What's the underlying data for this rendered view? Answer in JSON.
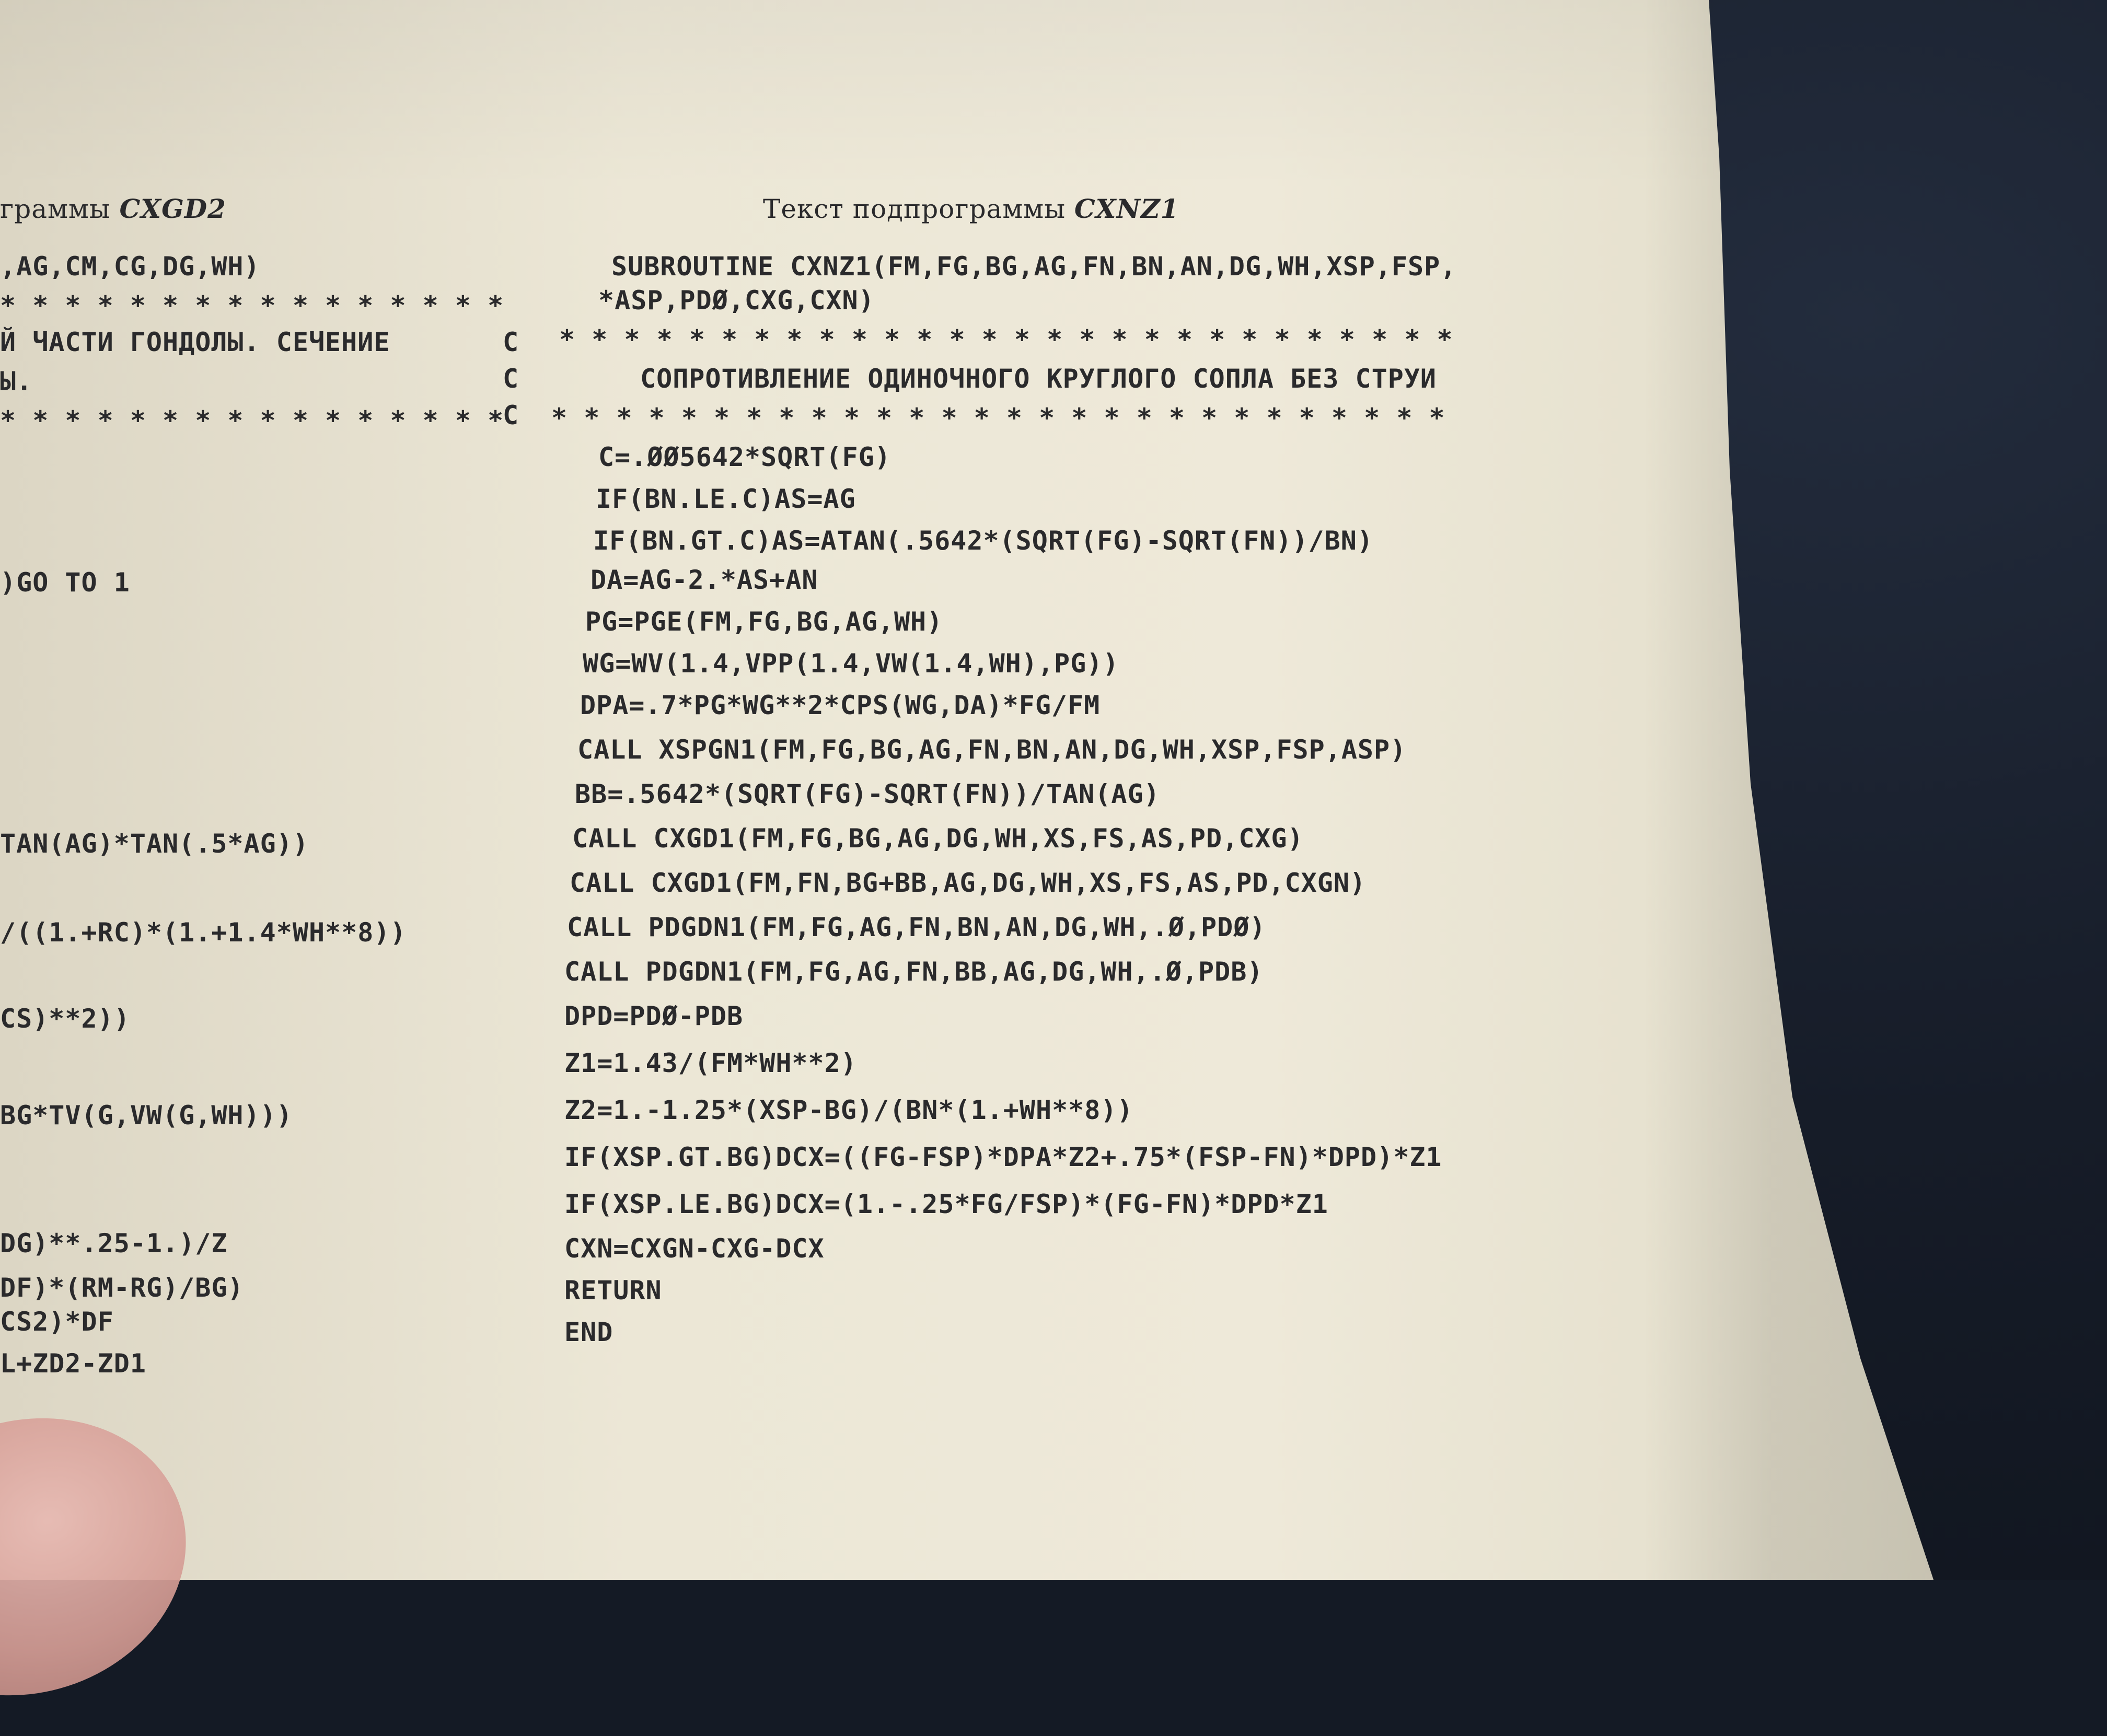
{
  "left_column": {
    "title_text": "граммы ",
    "title_name": "CXGD2",
    "lines": [
      ",AG,CM,CG,DG,WH)",
      "* * * * * * * * * * * * * * * *",
      "Й ЧАСТИ ГОНДОЛЫ. СЕЧЕНИЕ",
      "Ы.",
      "* * * * * * * * * * * * * * * *",
      ")GO TO 1",
      "TAN(AG)*TAN(.5*AG))",
      "/((1.+RC)*(1.+1.4*WH**8))",
      "CS)**2))",
      "BG*TV(G,VW(G,WH)))",
      "DG)**.25-1.)/Z",
      "DF)*(RM-RG)/BG)",
      "CS2)*DF",
      "L+ZD2-ZD1"
    ]
  },
  "comment_markers": [
    "C",
    "C",
    "C"
  ],
  "right_column": {
    "title_text": "Текст подпрограммы ",
    "title_name": "CXNZ1",
    "lines": [
      "SUBROUTINE CXNZ1(FM,FG,BG,AG,FN,BN,AN,DG,WH,XSP,FSP,",
      "*ASP,PDØ,CXG,CXN)",
      "* * * * * * * * * * * * * * * * * * * * * * * * * * * *",
      "СОПРОТИВЛЕНИЕ ОДИНОЧНОГО КРУГЛОГО СОПЛА БЕЗ СТРУИ",
      "* * * * * * * * * * * * * * * * * * * * * * * * * * * *",
      "C=.ØØ5642*SQRT(FG)",
      "IF(BN.LE.C)AS=AG",
      "IF(BN.GT.C)AS=ATAN(.5642*(SQRT(FG)-SQRT(FN))/BN)",
      "DA=AG-2.*AS+AN",
      "PG=PGE(FM,FG,BG,AG,WH)",
      "WG=WV(1.4,VPP(1.4,VW(1.4,WH),PG))",
      "DPA=.7*PG*WG**2*CPS(WG,DA)*FG/FM",
      "CALL XSPGN1(FM,FG,BG,AG,FN,BN,AN,DG,WH,XSP,FSP,ASP)",
      "BB=.5642*(SQRT(FG)-SQRT(FN))/TAN(AG)",
      "CALL CXGD1(FM,FG,BG,AG,DG,WH,XS,FS,AS,PD,CXG)",
      "CALL CXGD1(FM,FN,BG+BB,AG,DG,WH,XS,FS,AS,PD,CXGN)",
      "CALL PDGDN1(FM,FG,AG,FN,BN,AN,DG,WH,.Ø,PDØ)",
      "CALL PDGDN1(FM,FG,AG,FN,BB,AG,DG,WH,.Ø,PDB)",
      "DPD=PDØ-PDB",
      "Z1=1.43/(FM*WH**2)",
      "Z2=1.-1.25*(XSP-BG)/(BN*(1.+WH**8))",
      "IF(XSP.GT.BG)DCX=((FG-FSP)*DPA*Z2+.75*(FSP-FN)*DPD)*Z1",
      "IF(XSP.LE.BG)DCX=(1.-.25*FG/FSP)*(FG-FN)*DPD*Z1",
      "CXN=CXGN-CXG-DCX",
      "RETURN",
      "END"
    ]
  }
}
